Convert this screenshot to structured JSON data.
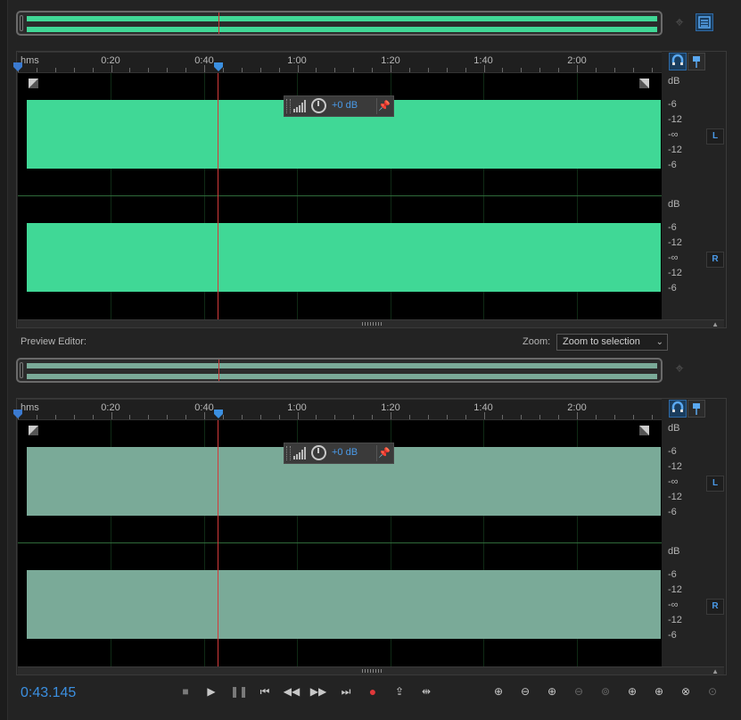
{
  "colors": {
    "wave_main": "#40d896",
    "wave_preview": "#7aaa98",
    "playhead": "#d23a3a",
    "accent_blue": "#3b8fe0"
  },
  "main_editor": {
    "ruler": {
      "unit_label": "hms",
      "ticks": [
        "0:20",
        "0:40",
        "1:00",
        "1:20",
        "1:40",
        "2:00"
      ]
    },
    "volume_hud": {
      "value": "+0 dB"
    },
    "channels": [
      {
        "badge": "L",
        "db_labels": [
          "dB",
          "-6",
          "-12",
          "-∞",
          "-12",
          "-6"
        ]
      },
      {
        "badge": "R",
        "db_labels": [
          "dB",
          "-6",
          "-12",
          "-∞",
          "-12",
          "-6"
        ]
      }
    ]
  },
  "preview": {
    "label": "Preview Editor:",
    "zoom_label": "Zoom:",
    "zoom_value": "Zoom to selection",
    "ruler": {
      "unit_label": "hms",
      "ticks": [
        "0:20",
        "0:40",
        "1:00",
        "1:20",
        "1:40",
        "2:00"
      ]
    },
    "volume_hud": {
      "value": "+0 dB"
    },
    "channels": [
      {
        "badge": "L",
        "db_labels": [
          "dB",
          "-6",
          "-12",
          "-∞",
          "-12",
          "-6"
        ]
      },
      {
        "badge": "R",
        "db_labels": [
          "dB",
          "-6",
          "-12",
          "-∞",
          "-12",
          "-6"
        ]
      }
    ]
  },
  "transport": {
    "time": "0:43.145",
    "icons": [
      "stop-icon",
      "play-icon",
      "pause-icon",
      "skip-to-start-icon",
      "rewind-icon",
      "fast-forward-icon",
      "skip-to-end-icon",
      "record-icon",
      "loop-playback-icon",
      "skip-selection-icon"
    ]
  },
  "zoom_icons": [
    "zoom-in-amplitude-icon",
    "zoom-out-amplitude-icon",
    "zoom-in-time-icon",
    "zoom-out-full-icon",
    "zoom-out-full-disabled-icon",
    "zoom-in-left-icon",
    "zoom-in-center-icon",
    "zoom-to-selection-icon",
    "zoom-reset-icon"
  ]
}
